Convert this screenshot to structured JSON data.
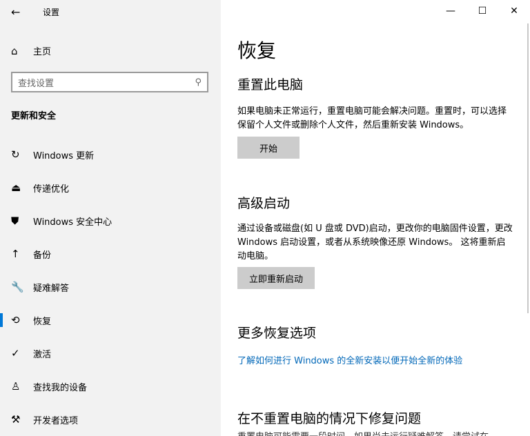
{
  "window": {
    "title": "设置",
    "minimize": "—",
    "maximize": "☐",
    "close": "✕"
  },
  "sidebar": {
    "back": "←",
    "home": "主页",
    "search_placeholder": "查找设置",
    "section": "更新和安全",
    "items": [
      {
        "icon": "↻",
        "label": "Windows 更新",
        "name": "sync"
      },
      {
        "icon": "⏏",
        "label": "传递优化",
        "name": "delivery"
      },
      {
        "icon": "⛊",
        "label": "Windows 安全中心",
        "name": "shield"
      },
      {
        "icon": "↑",
        "label": "备份",
        "name": "backup"
      },
      {
        "icon": "🔧",
        "label": "疑难解答",
        "name": "wrench"
      },
      {
        "icon": "⟲",
        "label": "恢复",
        "name": "recovery"
      },
      {
        "icon": "✓",
        "label": "激活",
        "name": "activation"
      },
      {
        "icon": "♙",
        "label": "查找我的设备",
        "name": "find-device"
      },
      {
        "icon": "⚒",
        "label": "开发者选项",
        "name": "developer"
      }
    ]
  },
  "main": {
    "title": "恢复",
    "reset": {
      "heading": "重置此电脑",
      "desc": "如果电脑未正常运行，重置电脑可能会解决问题。重置时，可以选择保留个人文件或删除个人文件，然后重新安装 Windows。",
      "button": "开始"
    },
    "advanced": {
      "heading": "高级启动",
      "desc": "通过设备或磁盘(如 U 盘或 DVD)启动，更改你的电脑固件设置，更改 Windows 启动设置，或者从系统映像还原 Windows。 这将重新启动电脑。",
      "button": "立即重新启动"
    },
    "more": {
      "heading": "更多恢复选项",
      "link": "了解如何进行 Windows 的全新安装以便开始全新的体验"
    },
    "fix": {
      "heading": "在不重置电脑的情况下修复问题",
      "desc": "重置电脑可能需要一段时间。如果尚未运行疑难解答，请尝试在"
    }
  }
}
